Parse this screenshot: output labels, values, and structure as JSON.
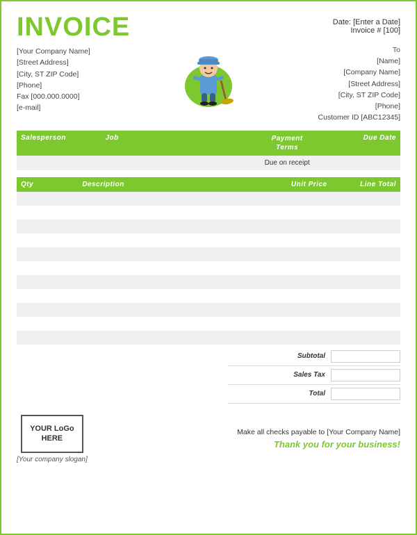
{
  "page": {
    "border_color": "#7dc82e"
  },
  "header": {
    "title": "INVOICE",
    "date_label": "Date:",
    "date_value": "[Enter a Date]",
    "invoice_label": "Invoice #",
    "invoice_value": "[100]"
  },
  "sender": {
    "company": "[Your Company Name]",
    "address": "[Street Address]",
    "city": "[City, ST  ZIP Code]",
    "phone": "[Phone]",
    "fax": "Fax [000.000.0000]",
    "email": "[e-mail]"
  },
  "recipient": {
    "to_label": "To",
    "name": "[Name]",
    "company": "[Company Name]",
    "address": "[Street Address]",
    "city": "[City, ST  ZIP Code]",
    "phone": "[Phone]",
    "customer_id": "Customer ID [ABC12345]"
  },
  "salesperson_table": {
    "headers": {
      "salesperson": "Salesperson",
      "job": "Job",
      "payment_terms": "Payment\nTerms",
      "due_date": "Due Date"
    },
    "row": {
      "salesperson": "",
      "job": "",
      "payment_terms": "Due on receipt",
      "due_date": ""
    }
  },
  "items_table": {
    "headers": {
      "qty": "Qty",
      "description": "Description",
      "unit_price": "Unit Price",
      "line_total": "Line Total"
    },
    "rows": [
      {
        "qty": "",
        "description": "",
        "unit_price": "",
        "line_total": ""
      },
      {
        "qty": "",
        "description": "",
        "unit_price": "",
        "line_total": ""
      },
      {
        "qty": "",
        "description": "",
        "unit_price": "",
        "line_total": ""
      },
      {
        "qty": "",
        "description": "",
        "unit_price": "",
        "line_total": ""
      },
      {
        "qty": "",
        "description": "",
        "unit_price": "",
        "line_total": ""
      },
      {
        "qty": "",
        "description": "",
        "unit_price": "",
        "line_total": ""
      },
      {
        "qty": "",
        "description": "",
        "unit_price": "",
        "line_total": ""
      },
      {
        "qty": "",
        "description": "",
        "unit_price": "",
        "line_total": ""
      },
      {
        "qty": "",
        "description": "",
        "unit_price": "",
        "line_total": ""
      },
      {
        "qty": "",
        "description": "",
        "unit_price": "",
        "line_total": ""
      }
    ]
  },
  "totals": {
    "subtotal_label": "Subtotal",
    "sales_tax_label": "Sales Tax",
    "total_label": "Total",
    "subtotal_value": "",
    "sales_tax_value": "",
    "total_value": ""
  },
  "footer": {
    "logo_text": "YOUR LoGo HERE",
    "slogan": "[Your company slogan]",
    "payable_text": "Make all checks payable to [Your Company Name]",
    "thanks_text": "Thank you for your business!"
  }
}
